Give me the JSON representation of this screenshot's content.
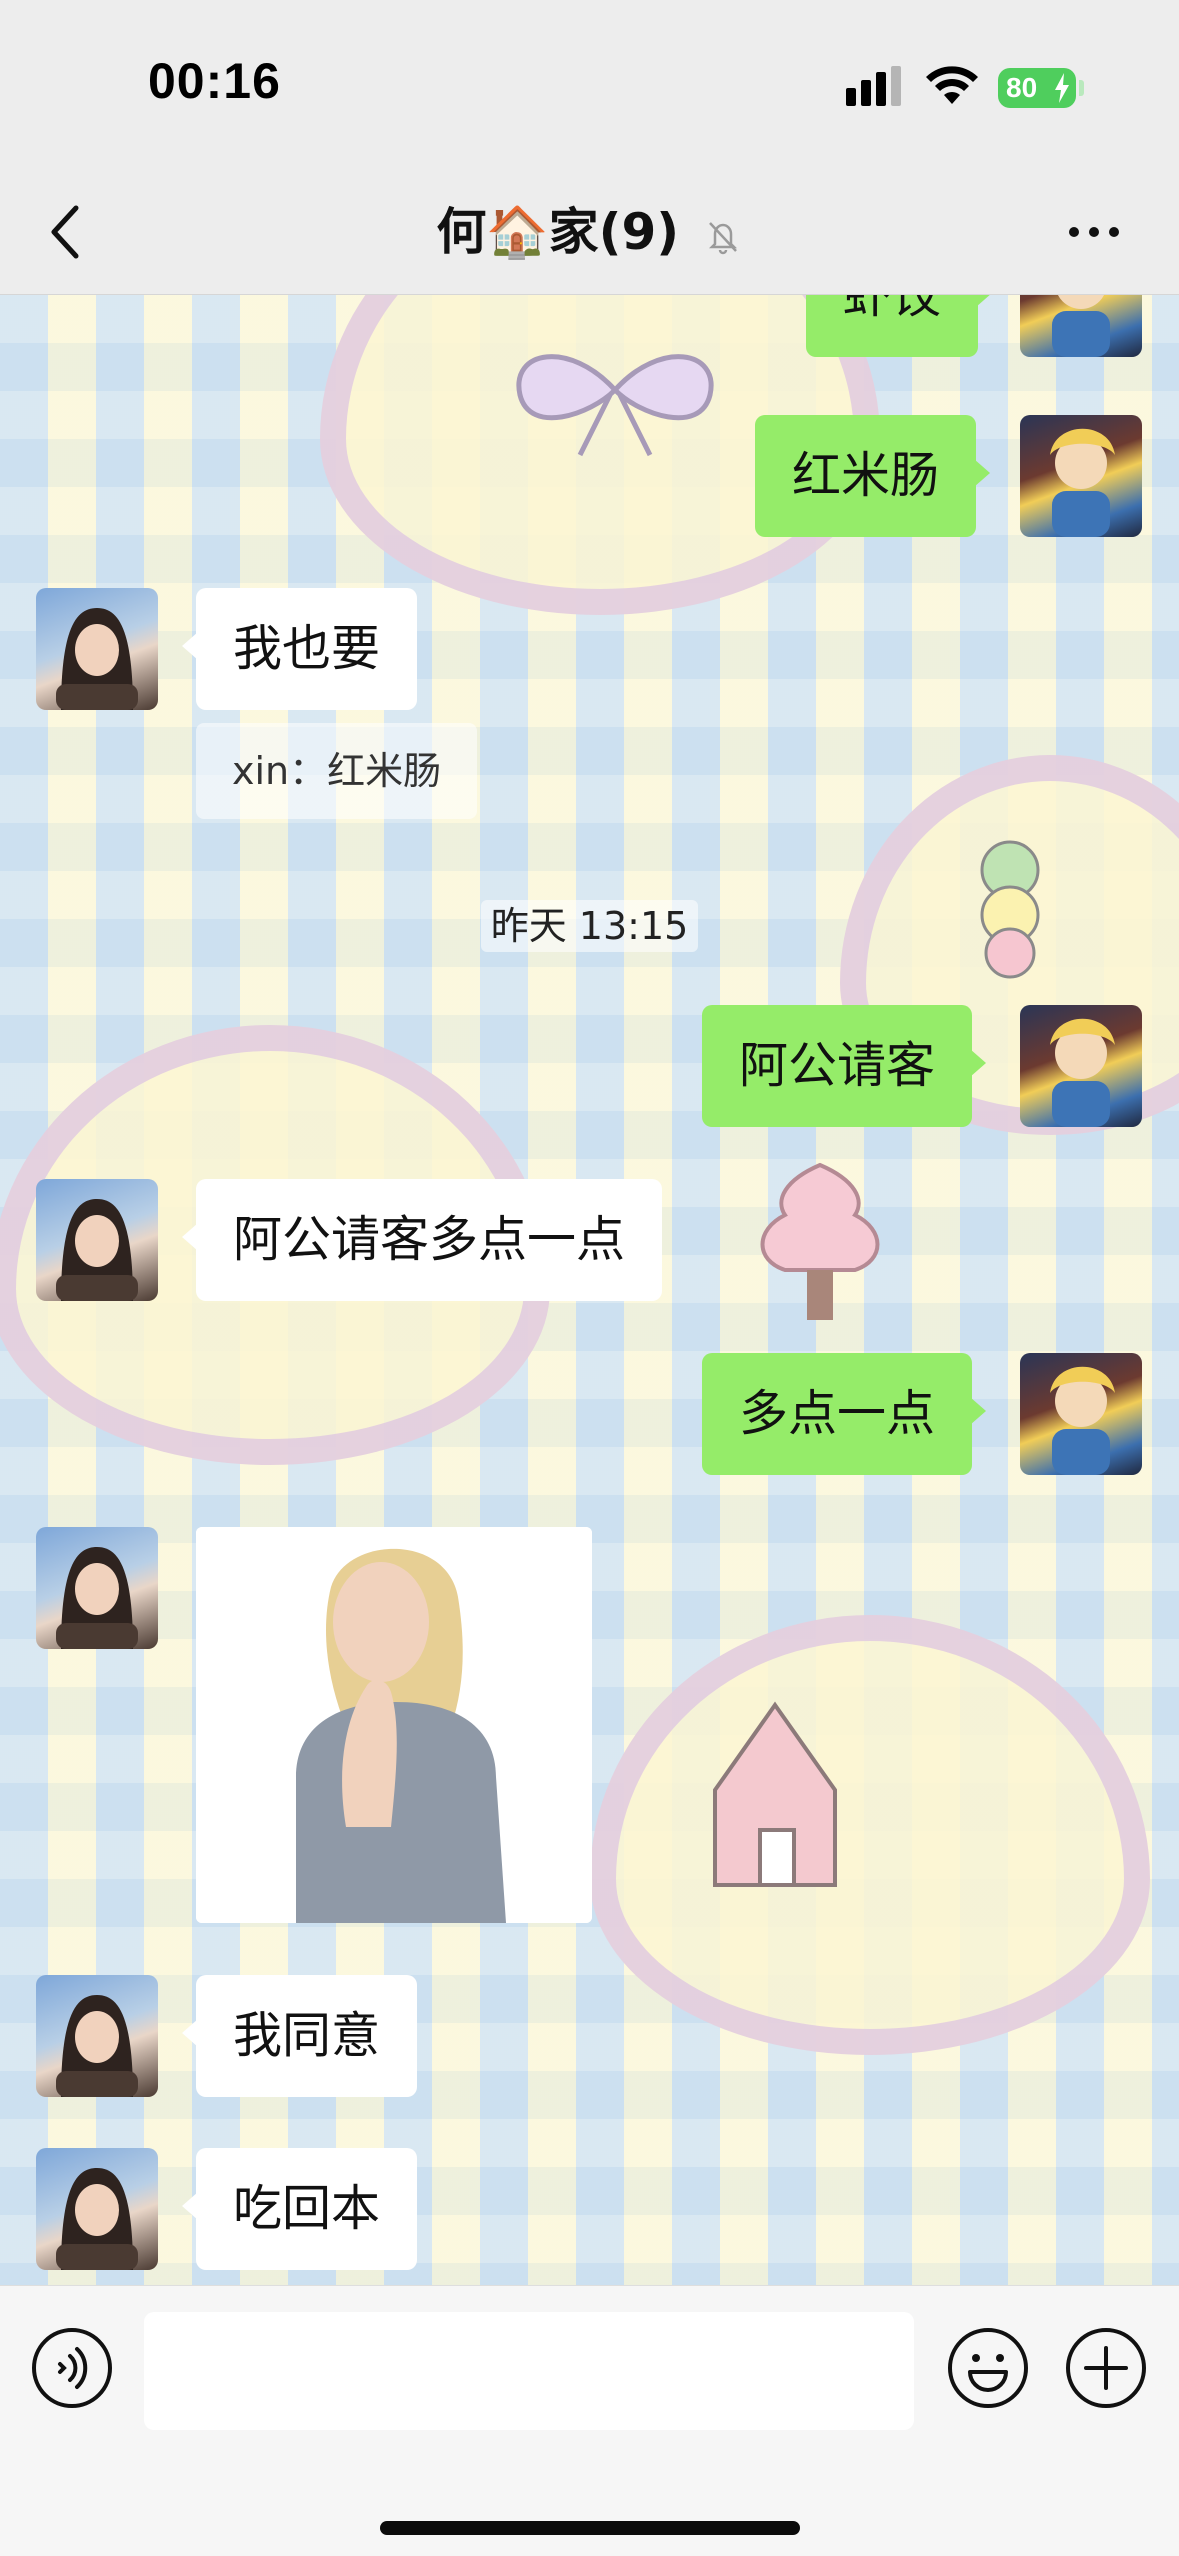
{
  "status_bar": {
    "time": "00:16",
    "battery": "80",
    "battery_color": "#4fce5d"
  },
  "header": {
    "title": "何🏠家(9)",
    "back_icon": "chevron-left-icon",
    "mute_icon": "bell-slash-icon",
    "more_icon": "ellipsis-icon"
  },
  "messages": [
    {
      "side": "out",
      "type": "text",
      "text": "虾饺"
    },
    {
      "side": "out",
      "type": "text",
      "text": "红米肠"
    },
    {
      "side": "in",
      "type": "text",
      "text": "我也要",
      "quote": "xin：红米肠"
    },
    {
      "type": "time",
      "text": "昨天 13:15"
    },
    {
      "side": "out",
      "type": "text",
      "text": "阿公请客"
    },
    {
      "side": "in",
      "type": "text",
      "text": "阿公请客多点一点"
    },
    {
      "side": "out",
      "type": "text",
      "text": "多点一点"
    },
    {
      "side": "in",
      "type": "sticker",
      "sticker": "praying-woman-sticker"
    },
    {
      "side": "in",
      "type": "text",
      "text": "我同意"
    },
    {
      "side": "in",
      "type": "text",
      "text": "吃回本"
    }
  ],
  "input_bar": {
    "voice_icon": "voice-icon",
    "message_value": "",
    "emoji_icon": "emoji-icon",
    "plus_icon": "plus-icon"
  },
  "colors": {
    "outgoing_bubble": "#95ec69",
    "incoming_bubble": "#ffffff",
    "background": "#ededed"
  }
}
